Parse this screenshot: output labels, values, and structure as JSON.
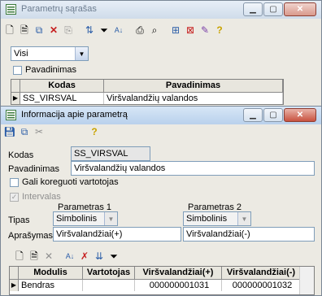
{
  "win1": {
    "title": "Parametrų sąrašas",
    "filter_value": "Visi",
    "pavadinimas_label": "Pavadinimas",
    "columns": [
      "Kodas",
      "Pavadinimas"
    ],
    "rows": [
      {
        "kodas": "SS_VIRSVAL",
        "pavadinimas": "Viršvalandžių valandos"
      }
    ]
  },
  "win2": {
    "title": "Informacija apie parametrą",
    "kodas_label": "Kodas",
    "kodas_value": "SS_VIRSVAL",
    "pavadinimas_label": "Pavadinimas",
    "pavadinimas_value": "Viršvalandžių valandos",
    "gali_koreguoti_label": "Gali koreguoti vartotojas",
    "intervalas_label": "Intervalas",
    "param1_header": "Parametras 1",
    "param2_header": "Parametras 2",
    "tipas_label": "Tipas",
    "tipas1_value": "Simbolinis",
    "tipas2_value": "Simbolinis",
    "aprasymas_label": "Aprašymas",
    "aprasymas1_value": "Viršvalandžiai(+)",
    "aprasymas2_value": "Viršvalandžiai(-)",
    "columns": [
      "Modulis",
      "Vartotojas",
      "Viršvalandžiai(+)",
      "Viršvalandžiai(-)"
    ],
    "rows": [
      {
        "modulis": "Bendras",
        "vartotojas": "",
        "plus": "000000001031",
        "minus": "000000001032"
      }
    ]
  },
  "icons": {
    "window_controls": [
      "minimize-icon",
      "maximize-icon",
      "close-icon"
    ]
  }
}
